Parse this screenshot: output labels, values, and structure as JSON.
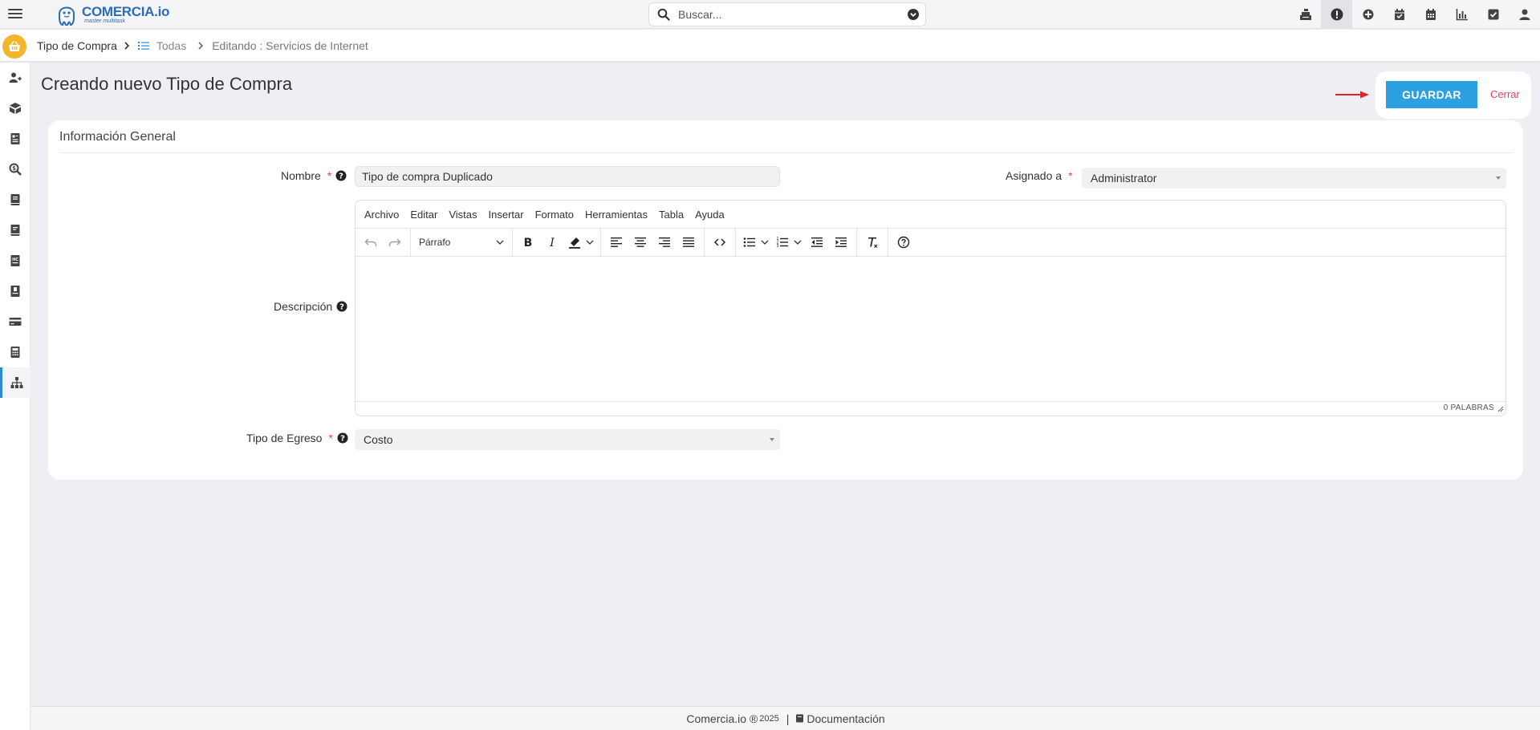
{
  "brand": {
    "name": "COMERCIA.io",
    "tagline": "master multitask",
    "color": "#2a6db5"
  },
  "search": {
    "placeholder": "Buscar..."
  },
  "topbar_icons": [
    "cash-register-icon",
    "alert-icon",
    "plus-circle-icon",
    "calendar-check-icon",
    "calendar-icon",
    "chart-icon",
    "checkbox-icon",
    "user-icon"
  ],
  "breadcrumb": {
    "module": "Tipo de Compra",
    "list": "Todas",
    "current": "Editando : Servicios de Internet"
  },
  "sidebar": {
    "items": [
      "users-arrow-icon",
      "box-icon",
      "id-card-icon",
      "search-dollar-icon",
      "book-icon",
      "book-alt-icon",
      "id-badge-icon",
      "book-bookmark-icon",
      "credit-card-icon",
      "calculator-icon",
      "sitemap-icon"
    ],
    "active": "sitemap-icon"
  },
  "page": {
    "title": "Creando nuevo Tipo de Compra"
  },
  "actions": {
    "save": "GUARDAR",
    "close": "Cerrar",
    "save_color": "#2ca0e0",
    "close_color": "#e2445c"
  },
  "form": {
    "section_title": "Información General",
    "nombre": {
      "label": "Nombre",
      "value": "Tipo de compra Duplicado"
    },
    "asignado": {
      "label": "Asignado a",
      "value": "Administrator"
    },
    "descripcion": {
      "label": "Descripción"
    },
    "tipo_egreso": {
      "label": "Tipo de Egreso",
      "value": "Costo"
    },
    "required_mark": "*"
  },
  "editor": {
    "menu": [
      "Archivo",
      "Editar",
      "Vistas",
      "Insertar",
      "Formato",
      "Herramientas",
      "Tabla",
      "Ayuda"
    ],
    "block_format": "Párrafo",
    "word_count": "0 PALABRAS"
  },
  "footer": {
    "brand": "Comercia.io ®",
    "year": "2025",
    "separator": "|",
    "docs": "Documentación"
  }
}
